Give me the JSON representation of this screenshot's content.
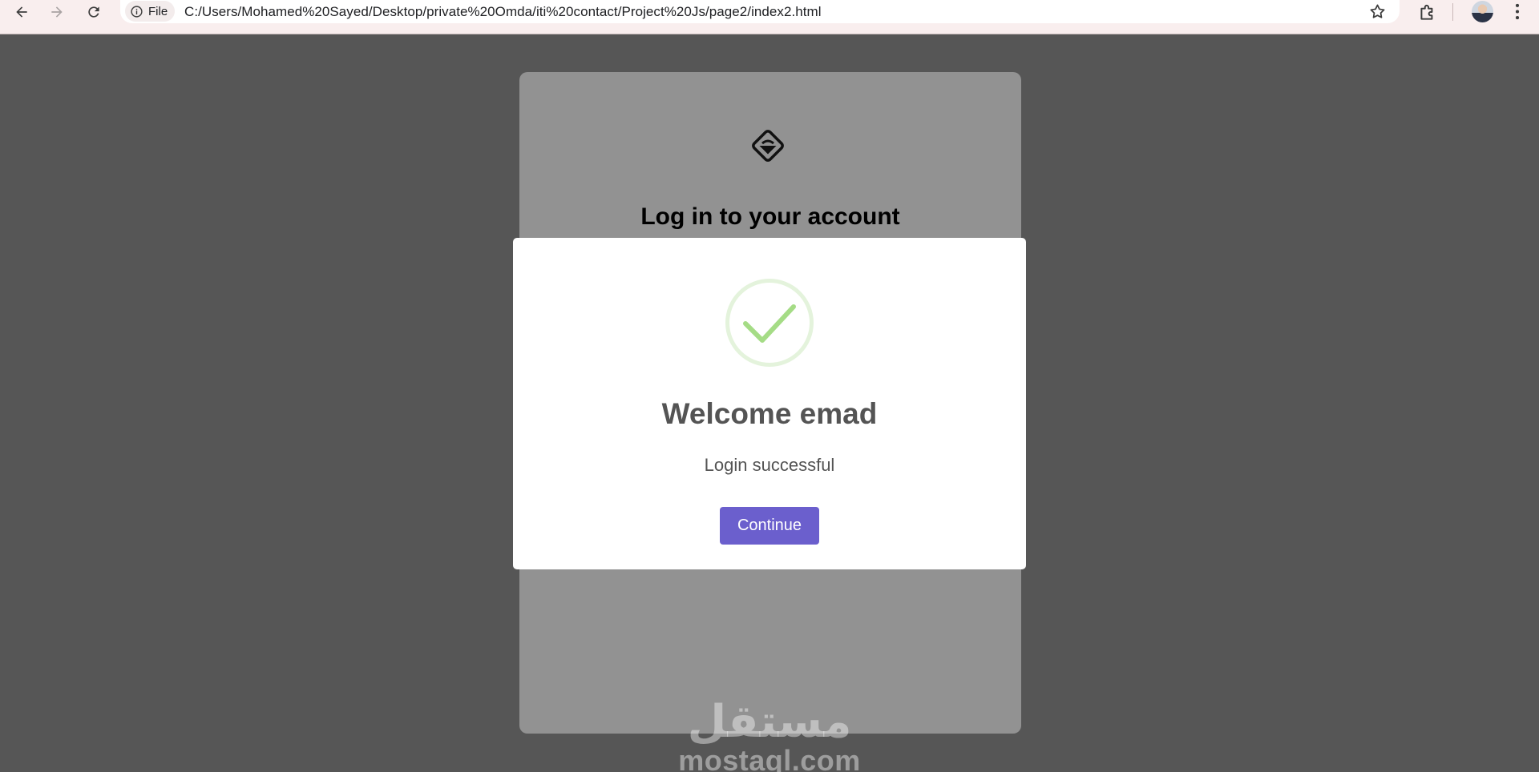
{
  "browser": {
    "back_icon": "arrow-left-icon",
    "forward_icon": "arrow-right-icon",
    "reload_icon": "reload-icon",
    "site_info_icon": "info-icon",
    "site_info_label": "File",
    "url": "C:/Users/Mohamed%20Sayed/Desktop/private%20Omda/iti%20contact/Project%20Js/page2/index2.html",
    "bookmark_icon": "star-icon",
    "extensions_icon": "puzzle-icon",
    "profile_icon": "avatar",
    "menu_icon": "kebab-menu-icon"
  },
  "login_card": {
    "logo_icon": "diamond-logo-icon",
    "title": "Log in to your account"
  },
  "modal": {
    "icon": "success-check-icon",
    "title": "Welcome emad",
    "text": "Login successful",
    "confirm_label": "Continue"
  },
  "watermark": {
    "arabic": "مستقل",
    "latin": "mostaql.com"
  },
  "colors": {
    "overlay": "#8f8f8f",
    "confirm_button": "#6b5fcd",
    "success_green": "#a5dc86",
    "chrome_bg": "#f9eeee"
  }
}
